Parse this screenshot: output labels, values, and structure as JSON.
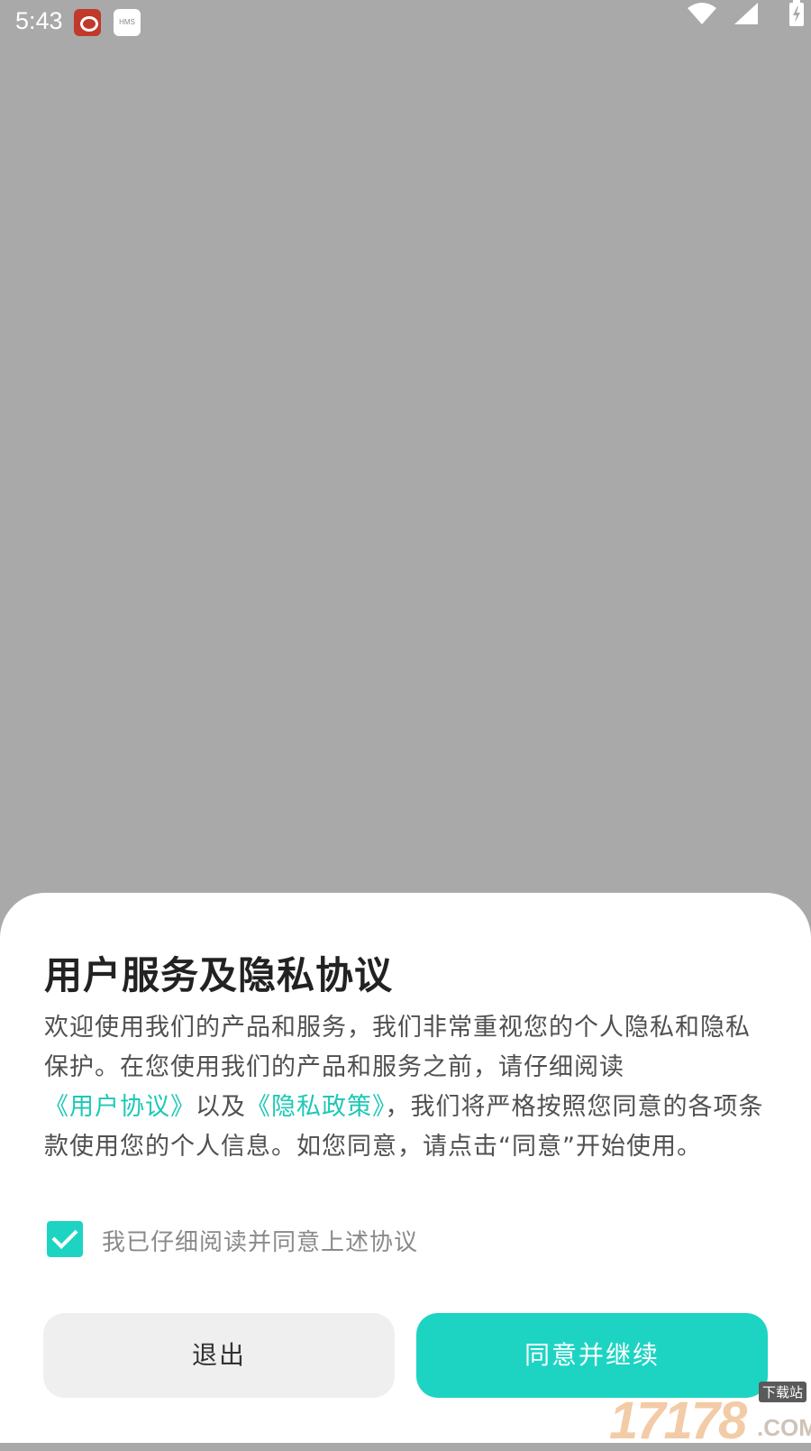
{
  "status_bar": {
    "time": "5:43",
    "notifications": [
      "weibo-icon",
      "hms-icon"
    ],
    "hms_text": "HMS",
    "system_icons": [
      "wifi-icon",
      "signal-icon",
      "battery-charging-icon"
    ]
  },
  "dialog": {
    "title": "用户服务及隐私协议",
    "body_part1": "欢迎使用我们的产品和服务，我们非常重视您的个人隐私和隐私保护。在您使用我们的产品和服务之前，请仔细阅读",
    "user_agreement_link": "《用户协议》",
    "body_part2": "以及",
    "privacy_policy_link": "《隐私政策》",
    "body_part3": "，我们将严格按照您同意的各项条款使用您的个人信息。如您同意，请点击“同意”开始使用。",
    "agree_checkbox": {
      "checked": true,
      "label": "我已仔细阅读并同意上述协议"
    },
    "exit_button": "退出",
    "agree_button": "同意并继续"
  },
  "watermark": {
    "number": "17178",
    "domain": ".COM",
    "tag": "下载站"
  },
  "colors": {
    "accent": "#1dd4c3",
    "link": "#1ec8b7",
    "overlay": "#a9a9a9"
  }
}
